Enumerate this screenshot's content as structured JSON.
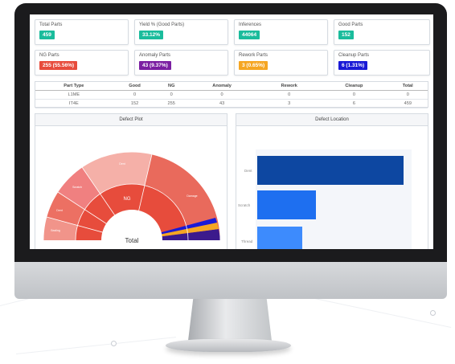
{
  "colors": {
    "teal": "#1abc9c",
    "red": "#e74c3c",
    "purple": "#7b1fa2",
    "orange": "#f5a623",
    "blue": "#1a1ad6",
    "bar_dark": "#0d47a1",
    "bar_mid": "#1e6ff0",
    "bar_light": "#3d8bfd"
  },
  "cards": [
    {
      "label": "Total Parts",
      "value": "459",
      "color": "#1abc9c"
    },
    {
      "label": "Yield % (Good Parts)",
      "value": "33.12%",
      "color": "#1abc9c"
    },
    {
      "label": "Inferences",
      "value": "44064",
      "color": "#1abc9c"
    },
    {
      "label": "Good Parts",
      "value": "152",
      "color": "#1abc9c"
    },
    {
      "label": "NG Parts",
      "value": "255 (55.56%)",
      "color": "#e74c3c"
    },
    {
      "label": "Anomaly Parts",
      "value": "43 (9.37%)",
      "color": "#7b1fa2"
    },
    {
      "label": "Rework Parts",
      "value": "3 (0.65%)",
      "color": "#f5a623"
    },
    {
      "label": "Cleanup Parts",
      "value": "6 (1.31%)",
      "color": "#1a1ad6"
    }
  ],
  "table": {
    "headers": [
      "Part Type",
      "Good",
      "NG",
      "Anomaly",
      "Rework",
      "Cleanup",
      "Total"
    ],
    "rows": [
      [
        "L1ME",
        "0",
        "0",
        "0",
        "0",
        "0",
        "0"
      ],
      [
        "IT4E",
        "152",
        "255",
        "43",
        "3",
        "6",
        "459"
      ]
    ]
  },
  "defect_plot": {
    "title": "Defect Plot",
    "center_label": "Total",
    "inner_label": "NG",
    "outer_labels": [
      "Dent",
      "Scratch",
      "Dent",
      "Damage",
      "Sealing"
    ]
  },
  "defect_location": {
    "title": "Defect Location",
    "bar_labels": [
      "Dent",
      "Scratch",
      "Thread"
    ],
    "bar_values": [
      0.98,
      0.39,
      0.3
    ]
  }
}
